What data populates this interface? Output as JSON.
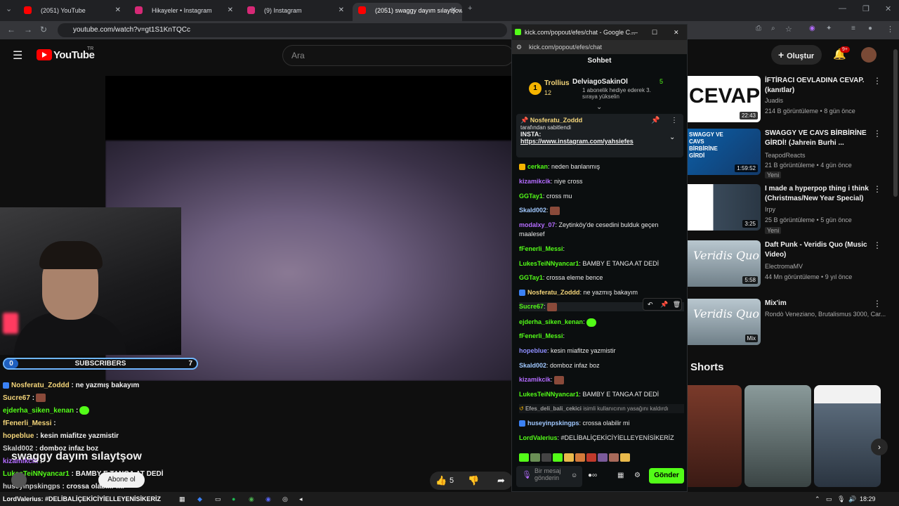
{
  "browser": {
    "tabs": [
      {
        "label": "(2051) YouTube",
        "color": "#ff0000"
      },
      {
        "label": "Hikayeler • Instagram",
        "color": "#d62976"
      },
      {
        "label": "(9) Instagram",
        "color": "#d62976"
      },
      {
        "label": "(2051) swaggy dayım sılaytşow",
        "color": "#ff0000"
      }
    ],
    "url": "youtube.com/watch?v=gt1S1KnTQCc"
  },
  "youtube": {
    "logo": "YouTube",
    "region": "TR",
    "search_placeholder": "Ara",
    "create_label": "Oluştur",
    "notif_count": "9+",
    "video_title": "swaggy dayım sılaytşow",
    "subscribe_label": "Abone ol",
    "likes": "5",
    "shorts_label": "Shorts",
    "recommendations": [
      {
        "title": "İFTİRACI OEVLADINA CEVAP. (kanıtlar)",
        "channel": "Juadis",
        "meta": "214 B görüntüleme • 8 gün önce",
        "duration": "22:43",
        "badge": "",
        "thumb_text": "CEVAP"
      },
      {
        "title": "SWAGGY VE CAVS BİRBİRİNE GİRDİ! (Jahrein Burhi ...",
        "channel": "TeapodReacts",
        "meta": "21 B görüntüleme • 4 gün önce",
        "duration": "1:59:52",
        "badge": "Yeni",
        "thumb_text": "SWAGGY VE CAVS BİRBİRİNE GİRDİ"
      },
      {
        "title": "I made a hyperpop thing i think (Christmas/New Year Special)",
        "channel": "Irpy",
        "meta": "25 B görüntüleme • 5 gün önce",
        "duration": "3:25",
        "badge": "Yeni",
        "thumb_text": ""
      },
      {
        "title": "Daft Punk - Veridis Quo (Music Video)",
        "channel": "ElectromaMV",
        "meta": "44 Mn görüntüleme • 9 yıl önce",
        "duration": "5:58",
        "badge": "",
        "thumb_text": "Veridis Quo"
      },
      {
        "title": "Mix'im",
        "channel": "Rondò Veneziano, Brutalismus 3000, Car...",
        "meta": "",
        "duration": "Mix",
        "badge": "",
        "thumb_text": "Veridis Quo"
      }
    ]
  },
  "stream_overlay": {
    "subs_left": "0",
    "subs_label": "SUBSCRIBERS",
    "subs_right": "7",
    "chat": [
      {
        "user": "Nosferatu_Zoddd",
        "text": " : ne yazmış bakayım",
        "color": "#f5d67a"
      },
      {
        "user": "Sucre67",
        "text": " :",
        "color": "#f5d67a"
      },
      {
        "user": "ejderha_siken_kenan",
        "text": " :",
        "color": "#53fc18"
      },
      {
        "user": "fFenerli_Messi",
        "text": " :",
        "color": "#f5d67a"
      },
      {
        "user": "hopeblue",
        "text": " : kesin miafitze yazmistir",
        "color": "#f5d67a"
      },
      {
        "user": "Skald002",
        "text": " : domboz infaz boz",
        "color": "#cfcfcf"
      },
      {
        "user": "kizamikcik",
        "text": " :",
        "color": "#b46cff"
      },
      {
        "user": "LukesTeiNNyancar1",
        "text": " : BAMBY E TANGA AT DEDİ",
        "color": "#53fc18"
      },
      {
        "user": "huseyinpskingps",
        "text": " : crossa olabilir mi",
        "color": "#cfcfcf"
      },
      {
        "user": "LordValerius",
        "text": " : #DELİBALİÇEKİCİYİELLEYENİSİKERİZ",
        "color": "#53fc18"
      }
    ]
  },
  "kick": {
    "window_title": "kick.com/popout/efes/chat - Google C...",
    "url": "kick.com/popout/efes/chat",
    "tab_label": "Sohbet",
    "leader_user": "Trollius",
    "leader_count": "12",
    "leader_rank": "1",
    "gift_user": "DelviagoSakinOl",
    "gift_count": "5",
    "gift_text": "1 abonelik hediye ederek 3. sıraya yükselin",
    "pinned_user": "Nosferatu_Zoddd",
    "pinned_by": "tarafından sabitlendi",
    "pinned_label": "INSTA:",
    "pinned_link": "https://www.instagram.com/yahsiefes",
    "messages": [
      {
        "user": "cerkan",
        "text": ": neden banlanmış",
        "color": "#53fc18"
      },
      {
        "user": "kizamikcik",
        "text": ": niye cross",
        "color": "#b46cff"
      },
      {
        "user": "GGTay1",
        "text": ": cross mu",
        "color": "#53fc18"
      },
      {
        "user": "Skald002",
        "text": ":",
        "color": "#a0c8ff"
      },
      {
        "user": "modalxy_07",
        "text": ": Zeytinköy'de cesedini bulduk geçen maalesef",
        "color": "#b46cff"
      },
      {
        "user": "fFenerli_Messi",
        "text": ":",
        "color": "#53fc18"
      },
      {
        "user": "LukesTeiNNyancar1",
        "text": ": BAMBY E TANGA AT DEDİ",
        "color": "#53fc18"
      },
      {
        "user": "GGTay1",
        "text": ": crossa eleme bence",
        "color": "#53fc18"
      },
      {
        "user": "Nosferatu_Zoddd",
        "text": ": ne yazmış bakayım",
        "color": "#f5d67a"
      },
      {
        "user": "Sucre67",
        "text": ":",
        "color": "#53fc18"
      },
      {
        "user": "ejderha_siken_kenan",
        "text": ":",
        "color": "#53fc18"
      },
      {
        "user": "fFenerli_Messi",
        "text": ":",
        "color": "#53fc18"
      },
      {
        "user": "hopeblue",
        "text": ": kesin miafitze yazmistir",
        "color": "#8f8fff"
      },
      {
        "user": "Skald002",
        "text": ": domboz infaz boz",
        "color": "#a0c8ff"
      },
      {
        "user": "kizamikcik",
        "text": ":",
        "color": "#b46cff"
      },
      {
        "user": "LukesTeiNNyancar1",
        "text": ": BAMBY E TANGA AT DEDİ",
        "color": "#53fc18"
      },
      {
        "user": "Efes_deli_bali_cekici",
        "text": " isimli kullanıcının yasağını kaldırdı",
        "color": "#9e9e9e"
      },
      {
        "user": "huseyinpskingps",
        "text": ": crossa olabilir mi",
        "color": "#a0c8ff"
      },
      {
        "user": "LordValerius",
        "text": ": #DELİBALİÇEKİCİYİELLEYENİSİKERİZ",
        "color": "#53fc18"
      }
    ],
    "input_placeholder": "Bir mesaj gönderin",
    "send_label": "Gönder"
  },
  "taskbar": {
    "ticker": "LordValerius: #DELİBALİÇEKİCİYİELLEYENİSİKERİZ",
    "time": "18:29"
  }
}
